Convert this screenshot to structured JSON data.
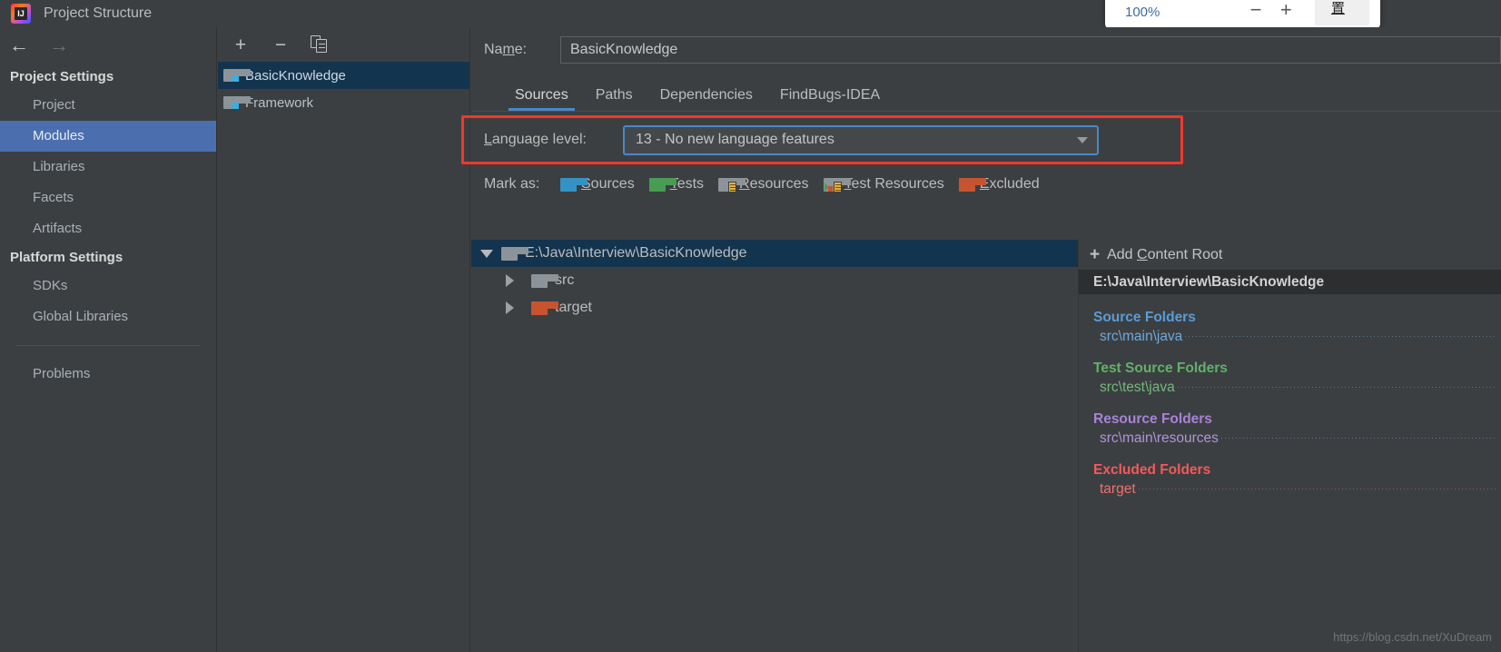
{
  "window": {
    "title": "Project Structure",
    "logo_text": "IJ"
  },
  "zoom_popup": {
    "percent": "100%",
    "minus": "−",
    "plus": "+",
    "reset_label": "重置"
  },
  "nav": {
    "back_arrow": "←",
    "forward_arrow": "→",
    "groups": [
      {
        "label": "Project Settings",
        "items": [
          {
            "label": "Project",
            "selected": false
          },
          {
            "label": "Modules",
            "selected": true
          },
          {
            "label": "Libraries",
            "selected": false
          },
          {
            "label": "Facets",
            "selected": false
          },
          {
            "label": "Artifacts",
            "selected": false
          }
        ]
      },
      {
        "label": "Platform Settings",
        "items": [
          {
            "label": "SDKs",
            "selected": false
          },
          {
            "label": "Global Libraries",
            "selected": false
          }
        ]
      }
    ],
    "problems_label": "Problems"
  },
  "modules_panel": {
    "toolbar": {
      "add": "+",
      "remove": "−",
      "copy": "copy-icon"
    },
    "items": [
      {
        "label": "BasicKnowledge",
        "selected": true
      },
      {
        "label": "Framework",
        "selected": false
      }
    ]
  },
  "main": {
    "name_label_pre": "Na",
    "name_label_mnemonic": "m",
    "name_label_post": "e:",
    "name_value": "BasicKnowledge",
    "tabs": [
      {
        "label": "Sources",
        "active": true
      },
      {
        "label": "Paths",
        "active": false
      },
      {
        "label": "Dependencies",
        "active": false
      },
      {
        "label": "FindBugs-IDEA",
        "active": false
      }
    ],
    "language_level": {
      "label_mnemonic": "L",
      "label_post": "anguage level:",
      "value": "13 - No new language features"
    },
    "mark_as": {
      "label": "Mark as:",
      "options": [
        {
          "mnemonic": "S",
          "rest": "ources",
          "icon": "folder-sources-icon",
          "color": "blue"
        },
        {
          "mnemonic": "T",
          "rest": "ests",
          "icon": "folder-tests-icon",
          "color": "green"
        },
        {
          "mnemonic": "R",
          "rest": "esources",
          "icon": "folder-resources-icon",
          "color": "gray"
        },
        {
          "mnemonic": "T",
          "rest": "est Resources",
          "icon": "folder-test-resources-icon",
          "color": "gray"
        },
        {
          "mnemonic": "E",
          "rest": "xcluded",
          "icon": "folder-excluded-icon",
          "color": "orange"
        }
      ]
    },
    "tree": [
      {
        "label": "E:\\Java\\Interview\\BasicKnowledge",
        "level": 0,
        "expanded": true,
        "selected": true,
        "folder": "gray"
      },
      {
        "label": "src",
        "level": 1,
        "expanded": false,
        "selected": false,
        "folder": "gray"
      },
      {
        "label": "target",
        "level": 1,
        "expanded": false,
        "selected": false,
        "folder": "orange"
      }
    ]
  },
  "right_panel": {
    "add_content_root": {
      "plus": "+",
      "pre": "Add ",
      "mnemonic": "C",
      "post": "ontent Root"
    },
    "content_root": "E:\\Java\\Interview\\BasicKnowledge",
    "groups": [
      {
        "heading": "Source Folders",
        "items": [
          "src\\main\\java"
        ]
      },
      {
        "heading": "Test Source Folders",
        "items": [
          "src\\test\\java"
        ]
      },
      {
        "heading": "Resource Folders",
        "items": [
          "src\\main\\resources"
        ]
      },
      {
        "heading": "Excluded Folders",
        "items": [
          "target"
        ]
      }
    ]
  },
  "watermark": "https://blog.csdn.net/XuDream",
  "colors": {
    "accent_blue": "#4a88c7",
    "selection_blue": "#4b6eaf",
    "tree_selection": "#13344f",
    "highlight_red": "#f4352b",
    "background": "#3c3f41"
  }
}
